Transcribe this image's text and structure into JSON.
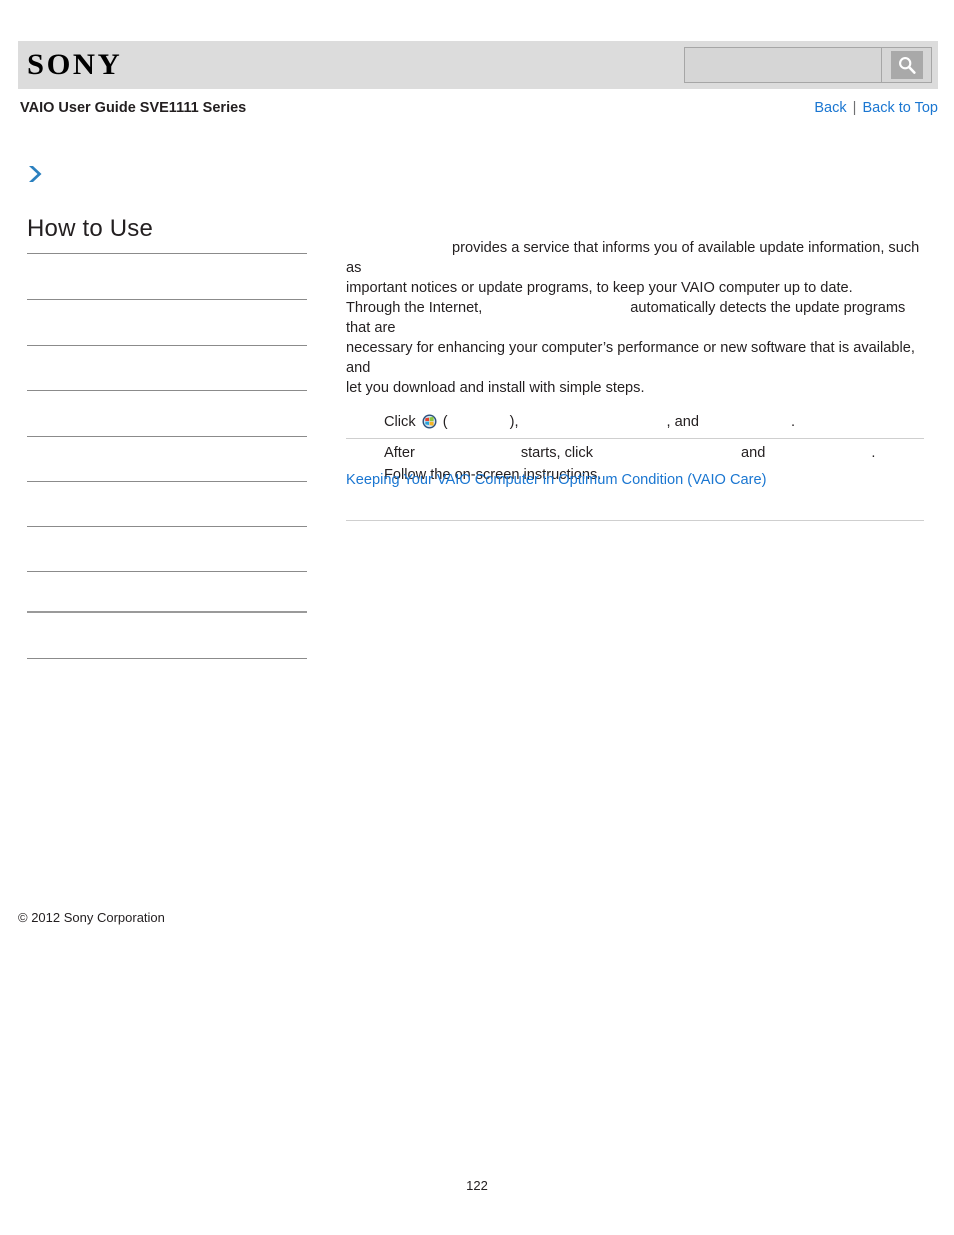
{
  "header": {
    "logo": "SONY",
    "logo_icon": "sony-wordmark",
    "search": {
      "value": "",
      "placeholder": "",
      "button_icon": "search-magnifier-icon",
      "button_label": ""
    }
  },
  "sub_header": {
    "guide_title": "VAIO User Guide SVE1111 Series",
    "links": [
      {
        "label": "Back"
      },
      {
        "label": "Back to Top"
      }
    ],
    "separator": "|"
  },
  "breadcrumb": {
    "arrow_icon": "chevron-right-icon"
  },
  "sidebar": {
    "title": "How to Use",
    "items": [
      {
        "label": "",
        "thick": false
      },
      {
        "label": "",
        "thick": false
      },
      {
        "label": "",
        "thick": false
      },
      {
        "label": "",
        "thick": false
      },
      {
        "label": "",
        "thick": false
      },
      {
        "label": "",
        "thick": false
      },
      {
        "label": "",
        "thick": false
      },
      {
        "label": "",
        "thick": false
      },
      {
        "label": "",
        "thick": true
      },
      {
        "label": "",
        "thick": false
      }
    ],
    "copyright": "© 2012 Sony Corporation"
  },
  "content": {
    "intro": {
      "line1_a": "",
      "line1_b": "provides a service that informs you of available update information, such as",
      "line2": "important notices or update programs, to keep your VAIO computer up to date.",
      "line3_a": "Through the Internet,",
      "line3_b": "automatically detects the update programs that are",
      "line4": "necessary for enhancing your computer’s performance or new software that is available, and",
      "line5": "let you download and install with simple steps."
    },
    "steps": [
      {
        "prefix": "Click",
        "icon": "windows-start-orb-icon",
        "paren_open": "(",
        "gap1": "",
        "paren_close": "),",
        "gap2": "",
        "conjunction": ", and",
        "gap3": "",
        "period": "."
      },
      {
        "prefix": "After",
        "gap1": "",
        "middle": "starts, click",
        "gap2": "",
        "conjunction": "and",
        "gap3": "",
        "period": "."
      },
      {
        "text": "Follow the on-screen instructions."
      }
    ],
    "related_link": "Keeping Your VAIO Computer in Optimum Condition (VAIO Care)"
  },
  "footer": {
    "page_number": "122"
  },
  "colors": {
    "header_bg": "#dcdcdc",
    "link_blue": "#1a76d1",
    "accent_chevron": "#2b80bf",
    "text": "#231f20",
    "rule_gray": "#cfcfcf",
    "nav_rule": "#8b8b8b"
  }
}
